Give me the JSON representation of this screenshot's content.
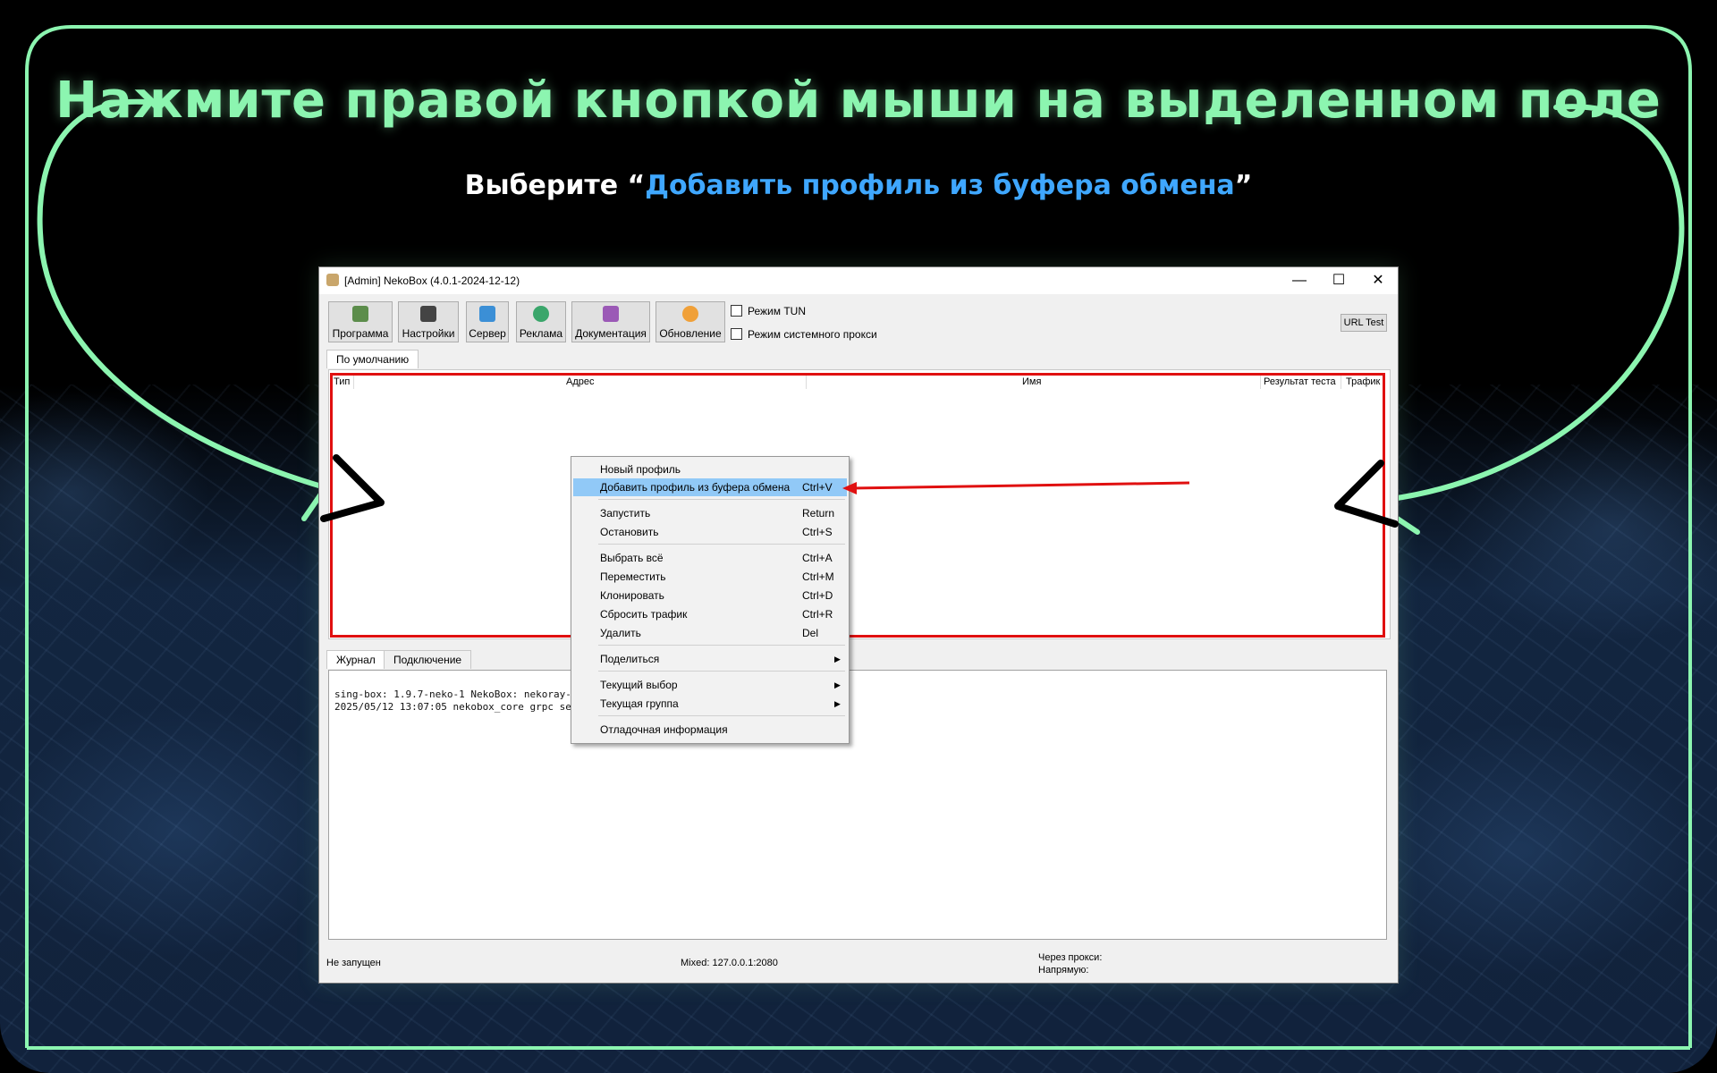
{
  "headline": "Нажмите правой кнопкой мыши на выделенном поле",
  "subtitle": {
    "prefix": "Выберите “",
    "accent": "Добавить профиль из буфера обмена",
    "suffix": "”"
  },
  "colors": {
    "accent_green": "#8cf5b0",
    "accent_blue": "#3fa7ff",
    "highlight_red": "#e01010",
    "menu_selection": "#91c9f7"
  },
  "window": {
    "title": "[Admin] NekoBox (4.0.1-2024-12-12)",
    "controls": {
      "minimize": "—",
      "maximize": "☐",
      "close": "✕"
    },
    "toolbar": [
      {
        "label": "Программа",
        "icon": "program-icon"
      },
      {
        "label": "Настройки",
        "icon": "settings-icon"
      },
      {
        "label": "Сервер",
        "icon": "server-icon"
      },
      {
        "label": "Реклама",
        "icon": "globe-icon"
      },
      {
        "label": "Документация",
        "icon": "help-icon"
      },
      {
        "label": "Обновление",
        "icon": "update-icon"
      }
    ],
    "tun_mode": "Режим TUN",
    "system_proxy": "Режим системного прокси",
    "url_test": "URL Test",
    "group_tab": "По умолчанию",
    "columns": [
      "Тип",
      "Адрес",
      "Имя",
      "Результат теста",
      "Трафик"
    ],
    "bottom_tabs": [
      "Журнал",
      "Подключение"
    ],
    "log_lines": [
      "sing-box: 1.9.7-neko-1 NekoBox: nekoray-",
      "2025/05/12 13:07:05 nekobox_core grpc se"
    ],
    "status": {
      "state": "Не запущен",
      "mixed": "Mixed: 127.0.0.1:2080",
      "via_proxy": "Через прокси:",
      "direct": "Напрямую:"
    }
  },
  "context_menu": [
    {
      "label": "Новый профиль",
      "shortcut": ""
    },
    {
      "label": "Добавить профиль из буфера обмена",
      "shortcut": "Ctrl+V",
      "selected": true
    },
    {
      "label": "Запустить",
      "shortcut": "Return"
    },
    {
      "label": "Остановить",
      "shortcut": "Ctrl+S"
    },
    {
      "label": "Выбрать всё",
      "shortcut": "Ctrl+A"
    },
    {
      "label": "Переместить",
      "shortcut": "Ctrl+M"
    },
    {
      "label": "Клонировать",
      "shortcut": "Ctrl+D"
    },
    {
      "label": "Сбросить трафик",
      "shortcut": "Ctrl+R"
    },
    {
      "label": "Удалить",
      "shortcut": "Del"
    },
    {
      "label": "Поделиться",
      "shortcut": "",
      "submenu": true
    },
    {
      "label": "Текущий выбор",
      "shortcut": "",
      "submenu": true
    },
    {
      "label": "Текущая группа",
      "shortcut": "",
      "submenu": true
    },
    {
      "label": "Отладочная информация",
      "shortcut": ""
    }
  ],
  "submenu_arrow": "▶"
}
